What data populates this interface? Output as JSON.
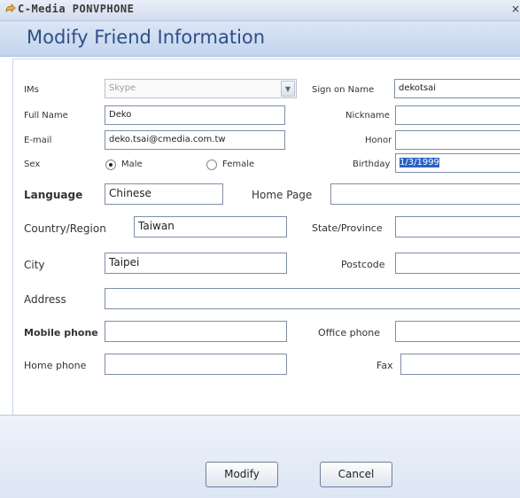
{
  "window": {
    "title": "C-Media PONVPHONE",
    "close_glyph": "×"
  },
  "header": {
    "title": "Modify Friend Information"
  },
  "form": {
    "ims": {
      "label": "IMs",
      "value": "Skype"
    },
    "sign_on_name": {
      "label": "Sign on Name",
      "value": "dekotsai"
    },
    "full_name": {
      "label": "Full Name",
      "value": "Deko"
    },
    "nickname": {
      "label": "Nickname",
      "value": ""
    },
    "email": {
      "label": "E-mail",
      "value": "deko.tsai@cmedia.com.tw"
    },
    "honor": {
      "label": "Honor",
      "value": ""
    },
    "sex": {
      "label": "Sex",
      "male": "Male",
      "female": "Female",
      "selected": "Male"
    },
    "birthday": {
      "label": "Birthday",
      "value": "1/3/1999"
    },
    "language": {
      "label": "Language",
      "value": "Chinese"
    },
    "home_page": {
      "label": "Home Page",
      "value": ""
    },
    "country": {
      "label": "Country/Region",
      "value": "Taiwan"
    },
    "state": {
      "label": "State/Province",
      "value": ""
    },
    "city": {
      "label": "City",
      "value": "Taipei"
    },
    "postcode": {
      "label": "Postcode",
      "value": ""
    },
    "address": {
      "label": "Address",
      "value": ""
    },
    "mobile_phone": {
      "label": "Mobile phone",
      "value": ""
    },
    "office_phone": {
      "label": "Office phone",
      "value": ""
    },
    "home_phone": {
      "label": "Home phone",
      "value": ""
    },
    "fax": {
      "label": "Fax",
      "value": ""
    }
  },
  "buttons": {
    "modify": "Modify",
    "cancel": "Cancel"
  }
}
